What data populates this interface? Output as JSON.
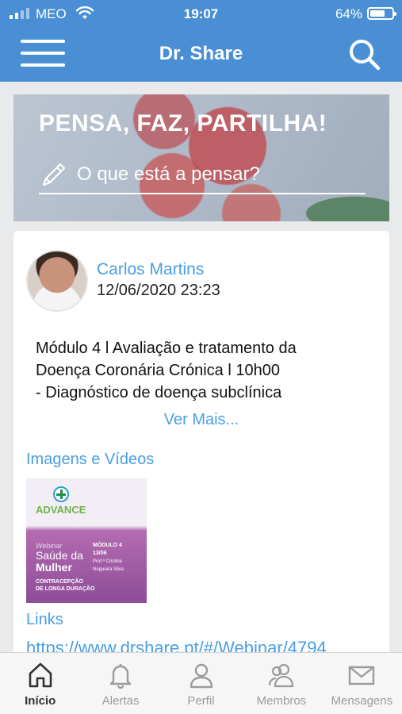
{
  "status_bar": {
    "carrier": "MEO",
    "time": "19:07",
    "battery": "64%"
  },
  "header": {
    "title": "Dr. Share",
    "menu_icon": "hamburger-menu-icon",
    "search_icon": "search-icon"
  },
  "banner": {
    "slogan": "PENSA, FAZ, PARTILHA!",
    "prompt": "O que está a pensar?",
    "prompt_icon": "pencil-icon"
  },
  "post": {
    "author": "Carlos Martins",
    "date": "12/06/2020 23:23",
    "body_lines": [
      "Módulo 4 l Avaliação e tratamento da",
      "Doença Coronária Crónica  l 10h00",
      "- Diagnóstico de doença subclínica"
    ],
    "more_label": "Ver Mais...",
    "media_label": "Imagens e Vídeos",
    "thumbnail": {
      "brand": "ADVANCE",
      "webinar": "Webinar",
      "title_line1": "Saúde da",
      "title_line2": "Mulher",
      "module": "MÓDULO 4",
      "date": "13/06",
      "speaker": "Prof.ª Cristina Nogueira Silva",
      "topic_line1": "CONTRACEPÇÃO",
      "topic_line2": "DE LONGA DURAÇÃO"
    },
    "links_label": "Links",
    "link_url": "https://www.drshare.pt/#/Webinar/4794"
  },
  "tabs": [
    {
      "label": "Início",
      "icon": "home-icon",
      "active": true
    },
    {
      "label": "Alertas",
      "icon": "bell-icon",
      "active": false
    },
    {
      "label": "Perfil",
      "icon": "user-icon",
      "active": false
    },
    {
      "label": "Membros",
      "icon": "users-icon",
      "active": false
    },
    {
      "label": "Mensagens",
      "icon": "mail-icon",
      "active": false
    }
  ],
  "colors": {
    "header_bg": "#4a8fd4",
    "link_blue": "#4a9ee6",
    "page_bg": "#e9eaec"
  }
}
